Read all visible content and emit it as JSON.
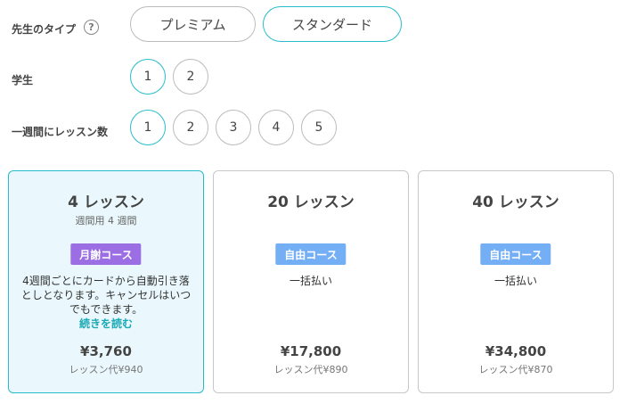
{
  "teacher_type": {
    "label": "先生のタイプ",
    "help_icon": "question-circle-icon",
    "help_glyph": "?",
    "options": [
      "プレミアム",
      "スタンダード"
    ],
    "selected": "スタンダード"
  },
  "students": {
    "label": "学生",
    "options": [
      "1",
      "2"
    ],
    "selected": "1"
  },
  "lessons_per_week": {
    "label": "一週間にレッスン数",
    "options": [
      "1",
      "2",
      "3",
      "4",
      "5"
    ],
    "selected": "1"
  },
  "plans": [
    {
      "title": "4 レッスン",
      "subtitle": "週間用 4 週間",
      "badge": "月謝コース",
      "badge_color": "#9b6ee3",
      "description": "4週間ごとにカードから自動引き落としとなります。キャンセルはいつでもできます。",
      "read_more": "続きを読む",
      "price": "¥3,760",
      "per_lesson": "レッスン代¥940",
      "selected": true
    },
    {
      "title": "20 レッスン",
      "badge": "自由コース",
      "badge_color": "#74aef5",
      "description": "一括払い",
      "price": "¥17,800",
      "per_lesson": "レッスン代¥890",
      "selected": false
    },
    {
      "title": "40 レッスン",
      "badge": "自由コース",
      "badge_color": "#74aef5",
      "description": "一括払い",
      "price": "¥34,800",
      "per_lesson": "レッスン代¥870",
      "selected": false
    }
  ],
  "accent_color": "#27bccb"
}
